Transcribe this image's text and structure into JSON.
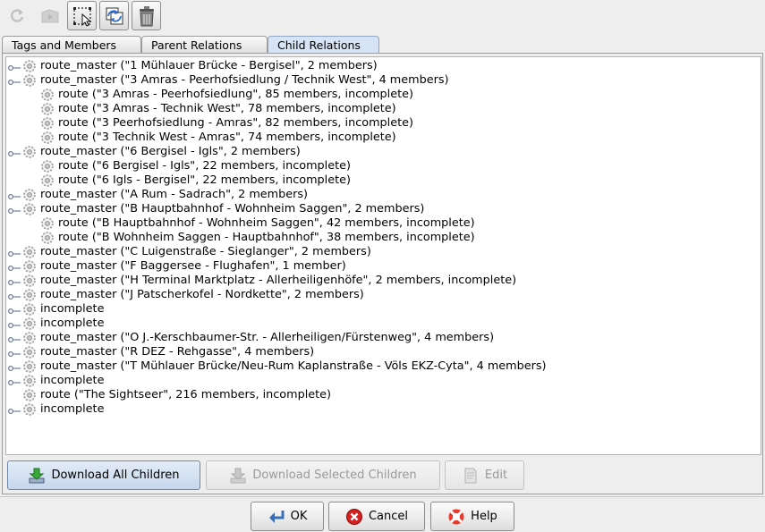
{
  "toolbar": {
    "buttons": [
      {
        "name": "reload-icon",
        "state": "disabled"
      },
      {
        "name": "zoom-icon",
        "state": "disabled"
      },
      {
        "name": "select-in-map-icon",
        "state": "enabled"
      },
      {
        "name": "edit-relation-icon",
        "state": "enabled"
      },
      {
        "name": "delete-icon",
        "state": "enabled"
      }
    ]
  },
  "tabs": [
    {
      "label": "Tags and Members",
      "active": false
    },
    {
      "label": "Parent Relations",
      "active": false
    },
    {
      "label": "Child Relations",
      "active": true
    }
  ],
  "tree": {
    "icons": {
      "row": "relation-icon",
      "handle": "tree-handle-icon"
    },
    "rows": [
      {
        "level": 0,
        "text": "route_master (\"1 Mühlauer Brücke - Bergisel\", 2 members)"
      },
      {
        "level": 0,
        "text": "route_master (\"3 Amras - Peerhofsiedlung / Technik West\", 4 members)"
      },
      {
        "level": 1,
        "text": "route (\"3 Amras - Peerhofsiedlung\", 85 members, incomplete)"
      },
      {
        "level": 1,
        "text": "route (\"3 Amras - Technik West\", 78 members, incomplete)"
      },
      {
        "level": 1,
        "text": "route (\"3 Peerhofsiedlung - Amras\", 82 members, incomplete)"
      },
      {
        "level": 1,
        "text": "route (\"3 Technik West - Amras\", 74 members, incomplete)"
      },
      {
        "level": 0,
        "text": "route_master (\"6 Bergisel - Igls\", 2 members)"
      },
      {
        "level": 1,
        "text": "route (\"6 Bergisel - Igls\", 22 members, incomplete)"
      },
      {
        "level": 1,
        "text": "route (\"6 Igls - Bergisel\", 22 members, incomplete)"
      },
      {
        "level": 0,
        "text": "route_master (\"A Rum - Sadrach\", 2 members)"
      },
      {
        "level": 0,
        "text": "route_master (\"B Hauptbahnhof - Wohnheim Saggen\", 2 members)"
      },
      {
        "level": 1,
        "text": "route (\"B Hauptbahnhof - Wohnheim Saggen\", 42 members, incomplete)"
      },
      {
        "level": 1,
        "text": "route (\"B Wohnheim Saggen - Hauptbahnhof\", 38 members, incomplete)"
      },
      {
        "level": 0,
        "text": "route_master (\"C Luigenstraße - Sieglanger\", 2 members)"
      },
      {
        "level": 0,
        "text": "route_master (\"F Baggersee - Flughafen\", 1 member)"
      },
      {
        "level": 0,
        "text": "route_master (\"H Terminal Marktplatz - Allerheiligenhöfe\", 2 members, incomplete)"
      },
      {
        "level": 0,
        "text": "route_master (\"J Patscherkofel - Nordkette\", 2 members)"
      },
      {
        "level": 0,
        "text": "incomplete"
      },
      {
        "level": 0,
        "text": "incomplete"
      },
      {
        "level": 0,
        "text": "route_master (\"O J.-Kerschbaumer-Str. - Allerheiligen/Fürstenweg\", 4 members)"
      },
      {
        "level": 0,
        "text": "route_master (\"R DEZ - Rehgasse\", 4 members)"
      },
      {
        "level": 0,
        "text": "route_master (\"T Mühlauer Brücke/Neu-Rum Kaplanstraße - Völs EKZ-Cyta\", 4 members)"
      },
      {
        "level": 0,
        "text": "incomplete"
      },
      {
        "level": 0,
        "text": "route (\"The Sightseer\", 216 members, incomplete)",
        "leaf": true
      },
      {
        "level": 0,
        "text": "incomplete"
      }
    ]
  },
  "panel_buttons": {
    "download_all": {
      "label": "Download All Children",
      "icon": "download-icon"
    },
    "download_selected": {
      "label": "Download Selected Children",
      "icon": "download-icon"
    },
    "edit": {
      "label": "Edit",
      "icon": "edit-icon"
    }
  },
  "dialog_buttons": {
    "ok": {
      "label": "OK",
      "icon": "ok-icon"
    },
    "cancel": {
      "label": "Cancel",
      "icon": "cancel-icon"
    },
    "help": {
      "label": "Help",
      "icon": "help-icon"
    }
  },
  "colors": {
    "active_tab": "#d6e4f5",
    "primary_button": "#c6d7ec",
    "cancel_red": "#d62020",
    "help_red": "#e63b2e"
  }
}
